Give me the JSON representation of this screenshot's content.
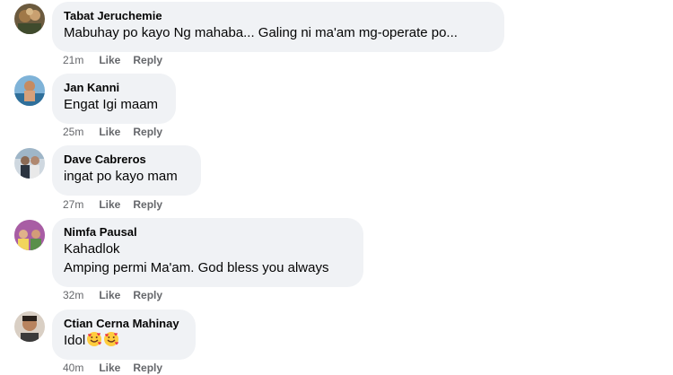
{
  "comments": [
    {
      "author": "Tabat Jeruchemie",
      "lines": [
        "Mabuhay po kayo Ng mahaba... Galing ni ma'am mg-operate po..."
      ],
      "time": "21m",
      "like": "Like",
      "reply": "Reply"
    },
    {
      "author": "Jan Kanni",
      "lines": [
        "Engat Igi maam"
      ],
      "time": "25m",
      "like": "Like",
      "reply": "Reply"
    },
    {
      "author": "Dave Cabreros",
      "lines": [
        "ingat po kayo mam"
      ],
      "time": "27m",
      "like": "Like",
      "reply": "Reply"
    },
    {
      "author": "Nimfa Pausal",
      "lines": [
        "Kahadlok",
        "Amping permi Ma'am. God bless you always"
      ],
      "time": "32m",
      "like": "Like",
      "reply": "Reply"
    },
    {
      "author": "Ctian Cerna Mahinay",
      "lines": [
        "Idol"
      ],
      "emojis": [
        "smiling-face-with-hearts",
        "smiling-face-with-hearts"
      ],
      "time": "40m",
      "like": "Like",
      "reply": "Reply"
    }
  ],
  "colors": {
    "bubble": "#f0f2f5",
    "text": "#050505",
    "meta": "#65676b"
  }
}
